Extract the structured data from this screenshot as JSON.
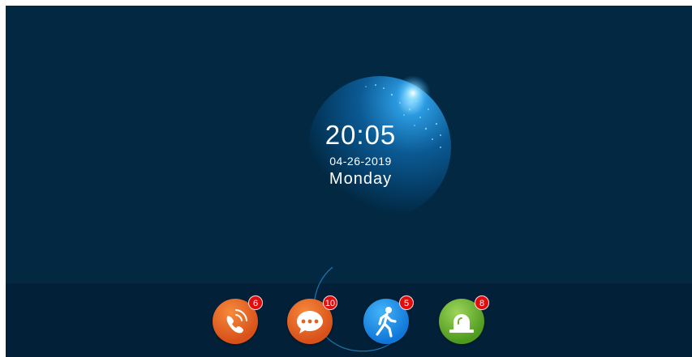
{
  "clock": {
    "time": "20:05",
    "date": "04-26-2019",
    "weekday": "Monday"
  },
  "dock": {
    "apps": [
      {
        "name": "call-log",
        "icon": "phone-icon",
        "badge": "6",
        "color": "#e0621f"
      },
      {
        "name": "messages",
        "icon": "chat-bubble-icon",
        "badge": "10",
        "color": "#e0621f"
      },
      {
        "name": "motion-detection",
        "icon": "walking-person-icon",
        "badge": "5",
        "color": "#1a8fe8"
      },
      {
        "name": "alarm",
        "icon": "alarm-siren-icon",
        "badge": "8",
        "color": "#6cb22c"
      }
    ]
  },
  "colors": {
    "background": "#022842",
    "dock_background": "#022139",
    "badge": "#e10d0d"
  }
}
